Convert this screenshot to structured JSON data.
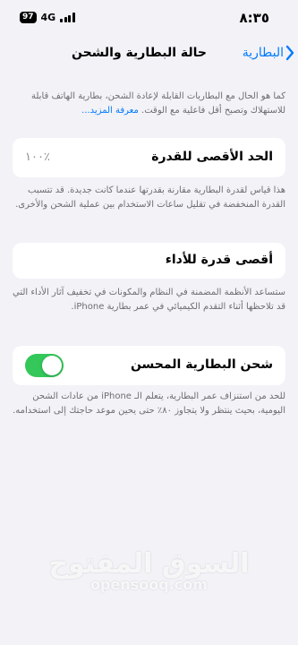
{
  "status": {
    "time": "٨:٣٥",
    "network": "4G",
    "battery_level": "97"
  },
  "nav": {
    "title": "حالة البطارية والشحن",
    "back_label": "البطارية"
  },
  "intro": {
    "text": "كما هو الحال مع البطاريات القابلة لإعادة الشحن، بطارية الهاتف قابلة للاستهلاك وتصبح أقل فاعلية مع الوقت.",
    "link": "معرفة المزيد..."
  },
  "max_capacity": {
    "label": "الحد الأقصى للقدرة",
    "value": "١٠٠٪",
    "description": "هذا قياس لقدرة البطارية مقارنة بقدرتها عندما كانت جديدة. قد تتسبب القدرة المنخفضة في تقليل ساعات الاستخدام بين عملية الشحن والأخرى."
  },
  "peak_performance": {
    "label": "أقصى قدرة للأداء",
    "description": "ستساعد الأنظمة المضمنة في النظام والمكونات في تخفيف آثار الأداء التي قد تلاحظها أثناء التقدم الكيميائي في عمر بطارية iPhone."
  },
  "optimized_charging": {
    "label": "شحن البطارية المحسن",
    "enabled": true,
    "description": "للحد من استنزاف عمر البطارية، يتعلم الـ iPhone من عادات الشحن اليومية، بحيث ينتظر ولا يتجاوز ٨٠٪ حتى يحين موعد حاجتك إلى استخدامه."
  },
  "watermark": {
    "arabic": "السوق المفتوح",
    "latin": "opensooq.com"
  }
}
